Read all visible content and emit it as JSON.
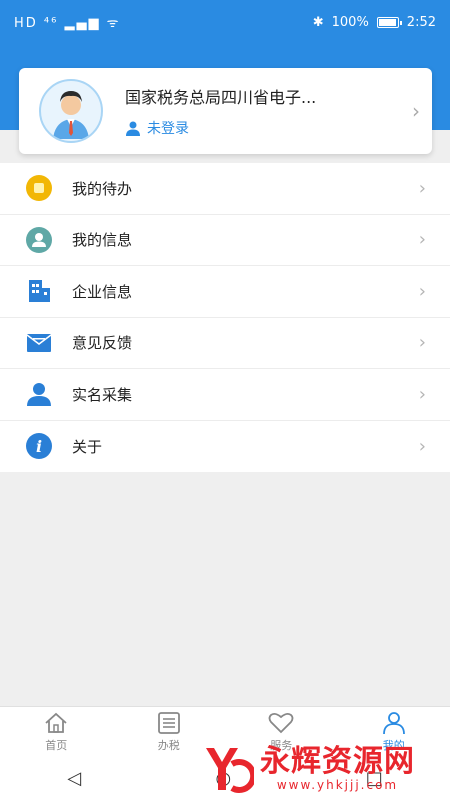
{
  "status_bar": {
    "left_icons": "HD ⁴⁶ ▂▄▆ ᯤ",
    "battery": "100%",
    "time": "2:52"
  },
  "profile": {
    "org_name": "国家税务总局四川省电子...",
    "login_status": "未登录"
  },
  "menu": {
    "items": [
      {
        "label": "我的待办",
        "icon": "todo-icon",
        "color": "#f2b705"
      },
      {
        "label": "我的信息",
        "icon": "user-info-icon",
        "color": "#5fa8a6"
      },
      {
        "label": "企业信息",
        "icon": "building-icon",
        "color": "#2a7fd6"
      },
      {
        "label": "意见反馈",
        "icon": "mail-icon",
        "color": "#2a7fd6"
      },
      {
        "label": "实名采集",
        "icon": "person-icon",
        "color": "#2a7fd6"
      },
      {
        "label": "关于",
        "icon": "info-icon",
        "color": "#2a7fd6"
      }
    ]
  },
  "tabbar": {
    "tabs": [
      {
        "label": "首页",
        "icon": "home-icon"
      },
      {
        "label": "办税",
        "icon": "list-icon"
      },
      {
        "label": "服务",
        "icon": "heart-icon"
      },
      {
        "label": "我的",
        "icon": "profile-icon",
        "active": true
      }
    ]
  },
  "watermark": {
    "title": "永辉资源网",
    "url": "www.yhkjjj.com"
  },
  "colors": {
    "primary": "#2a8be2",
    "background": "#efefef"
  }
}
